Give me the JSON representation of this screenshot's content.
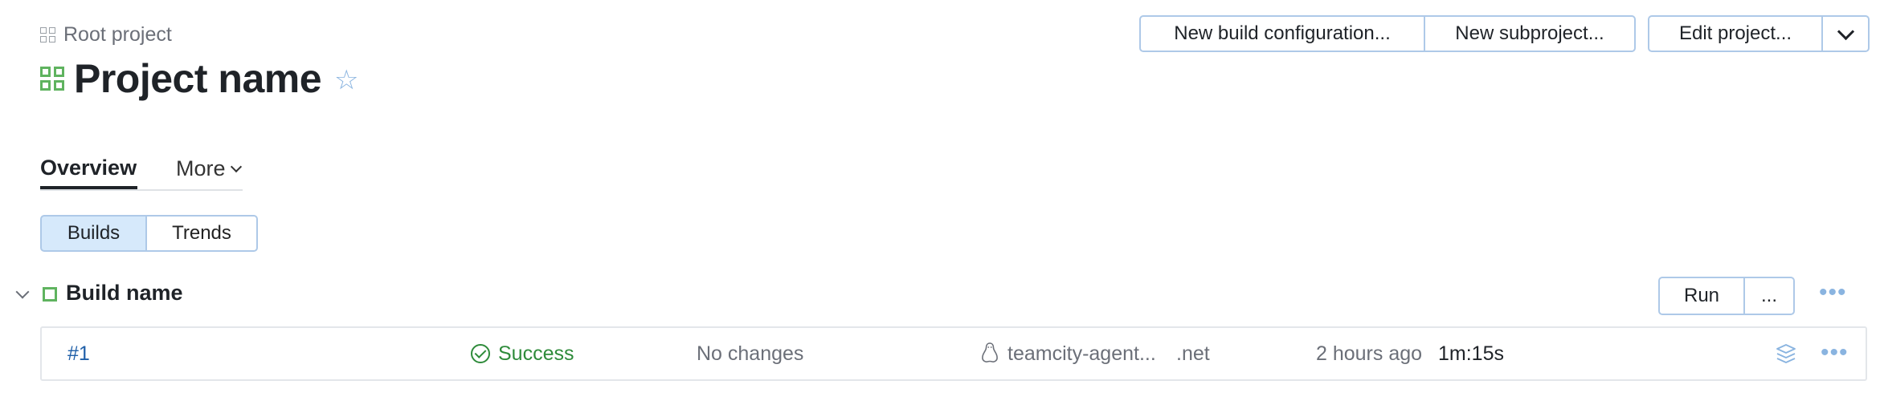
{
  "breadcrumb": {
    "label": "Root project"
  },
  "project": {
    "title": "Project name"
  },
  "header_buttons": {
    "new_build_configuration": "New build configuration...",
    "new_subproject": "New subproject...",
    "edit_project": "Edit project..."
  },
  "tabs": {
    "overview": "Overview",
    "more": "More"
  },
  "view_toggle": {
    "builds": "Builds",
    "trends": "Trends",
    "selected": "Builds"
  },
  "build_configuration": {
    "name": "Build name",
    "run_label": "Run",
    "run_options_label": "..."
  },
  "builds": [
    {
      "number": "#1",
      "status": "Success",
      "changes": "No changes",
      "agent": "teamcity-agent...",
      "agent_suffix": ".net",
      "started": "2 hours ago",
      "duration": "1m:15s"
    }
  ],
  "icons": {
    "project": "project-grid-icon",
    "favorite": "star-outline-icon",
    "status": "check-circle-icon",
    "agent_os": "linux-tux-icon",
    "artifacts": "layers-icon",
    "more": "ellipsis-icon"
  },
  "colors": {
    "accent_border": "#aec9e8",
    "selected_bg": "#d6e9fb",
    "success": "#2e8b3a",
    "link": "#1f5fa8",
    "project_icon": "#5fb35f"
  }
}
